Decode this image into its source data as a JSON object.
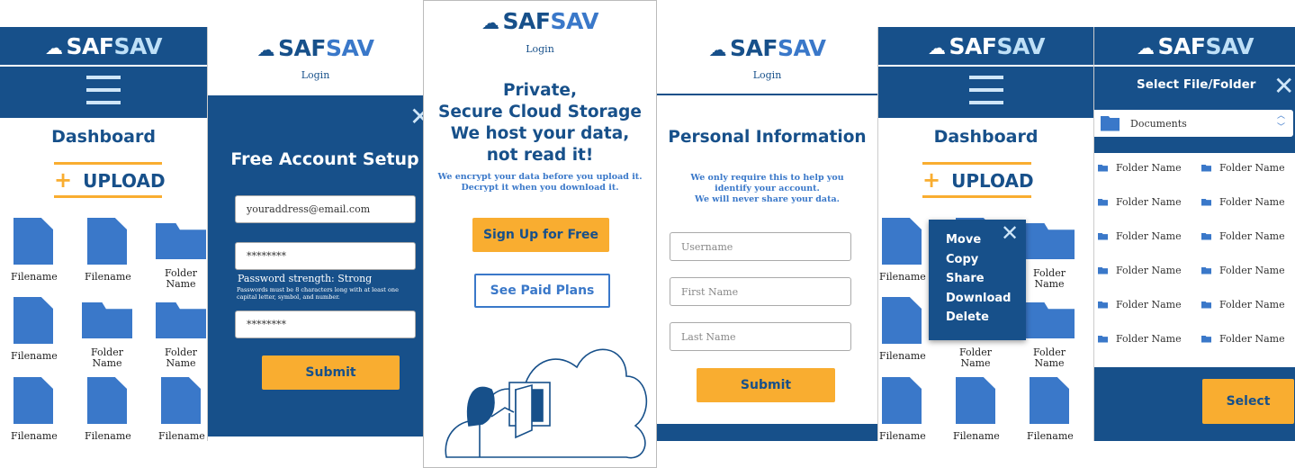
{
  "brand": {
    "a": "SAF",
    "b": "SAV",
    "icon": "cloud-lock-icon"
  },
  "colors": {
    "primary": "#17508a",
    "accent": "#f9ad30",
    "icon": "#3a78c9"
  },
  "dashboard": {
    "title": "Dashboard",
    "upload": "UPLOAD",
    "items": [
      {
        "type": "file",
        "name": "Filename"
      },
      {
        "type": "file",
        "name": "Filename"
      },
      {
        "type": "folder",
        "name": "Folder Name"
      },
      {
        "type": "file",
        "name": "Filename"
      },
      {
        "type": "folder",
        "name": "Folder Name"
      },
      {
        "type": "folder",
        "name": "Folder Name"
      },
      {
        "type": "file",
        "name": "Filename"
      },
      {
        "type": "file",
        "name": "Filename"
      },
      {
        "type": "file",
        "name": "Filename"
      }
    ]
  },
  "signup": {
    "login": "Login",
    "title": "Free Account Setup",
    "email": "youraddress@email.com",
    "password": "********",
    "strength": "Password strength: Strong",
    "rules": "Passwords must be 8 characters long with at least one capital letter, symbol, and number.",
    "confirm": "********",
    "submit": "Submit"
  },
  "landing": {
    "login": "Login",
    "headline1": "Private,",
    "headline2": "Secure Cloud Storage",
    "headline3": "We host your data,",
    "headline4": "not read it!",
    "sub1": "We encrypt your data before you upload it.",
    "sub2": "Decrypt it when you download it.",
    "signup": "Sign Up for Free",
    "plans": "See Paid Plans"
  },
  "personal": {
    "login": "Login",
    "title": "Personal Information",
    "note1": "We only require this to help you",
    "note2": "identify your account.",
    "note3": "We will never share your data.",
    "username": "Username",
    "first": "First Name",
    "last": "Last Name",
    "submit": "Submit"
  },
  "context_menu": {
    "items": [
      "Move",
      "Copy",
      "Share",
      "Download",
      "Delete"
    ]
  },
  "picker": {
    "title": "Select File/Folder",
    "folder": "Documents",
    "items": [
      "Folder Name",
      "Folder Name",
      "Folder Name",
      "Folder Name",
      "Folder Name",
      "Folder Name",
      "Folder Name",
      "Folder Name",
      "Folder Name",
      "Folder Name",
      "Folder Name",
      "Folder Name"
    ],
    "select": "Select"
  }
}
